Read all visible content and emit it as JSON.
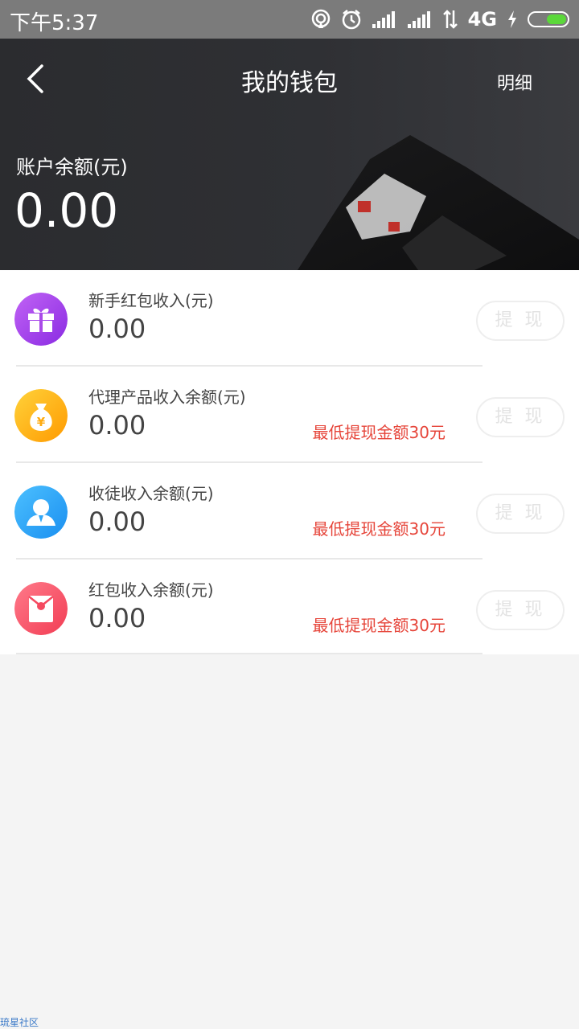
{
  "status_bar": {
    "time": "下午5:37",
    "network": "4G",
    "icons": [
      "hotspot-icon",
      "alarm-icon",
      "signal-icon",
      "signal-icon",
      "data-arrows-icon",
      "charging-icon",
      "battery-icon"
    ]
  },
  "nav": {
    "title": "我的钱包",
    "detail_label": "明细"
  },
  "balance": {
    "label": "账户余额(元)",
    "value": "0.00"
  },
  "items": [
    {
      "label": "新手红包收入(元)",
      "value": "0.00",
      "note": "",
      "button": "提 现",
      "icon": "gift-icon",
      "color_start": "#c163f5",
      "color_end": "#8a2be2"
    },
    {
      "label": "代理产品收入余额(元)",
      "value": "0.00",
      "note": "最低提现金额30元",
      "button": "提 现",
      "icon": "money-bag-icon",
      "color_start": "#ffd23a",
      "color_end": "#ff9a00"
    },
    {
      "label": "收徒收入余额(元)",
      "value": "0.00",
      "note": "最低提现金额30元",
      "button": "提 现",
      "icon": "user-icon",
      "color_start": "#4cc0ff",
      "color_end": "#1a8ff0"
    },
    {
      "label": "红包收入余额(元)",
      "value": "0.00",
      "note": "最低提现金额30元",
      "button": "提 现",
      "icon": "red-envelope-icon",
      "color_start": "#ff7a8a",
      "color_end": "#f23d54"
    }
  ],
  "colors": {
    "note": "#e6453a",
    "header_bg": "#2f3034",
    "status_bar": "#7b7b7b",
    "page_bg": "#f4f4f4"
  },
  "watermark": "琉星社区"
}
